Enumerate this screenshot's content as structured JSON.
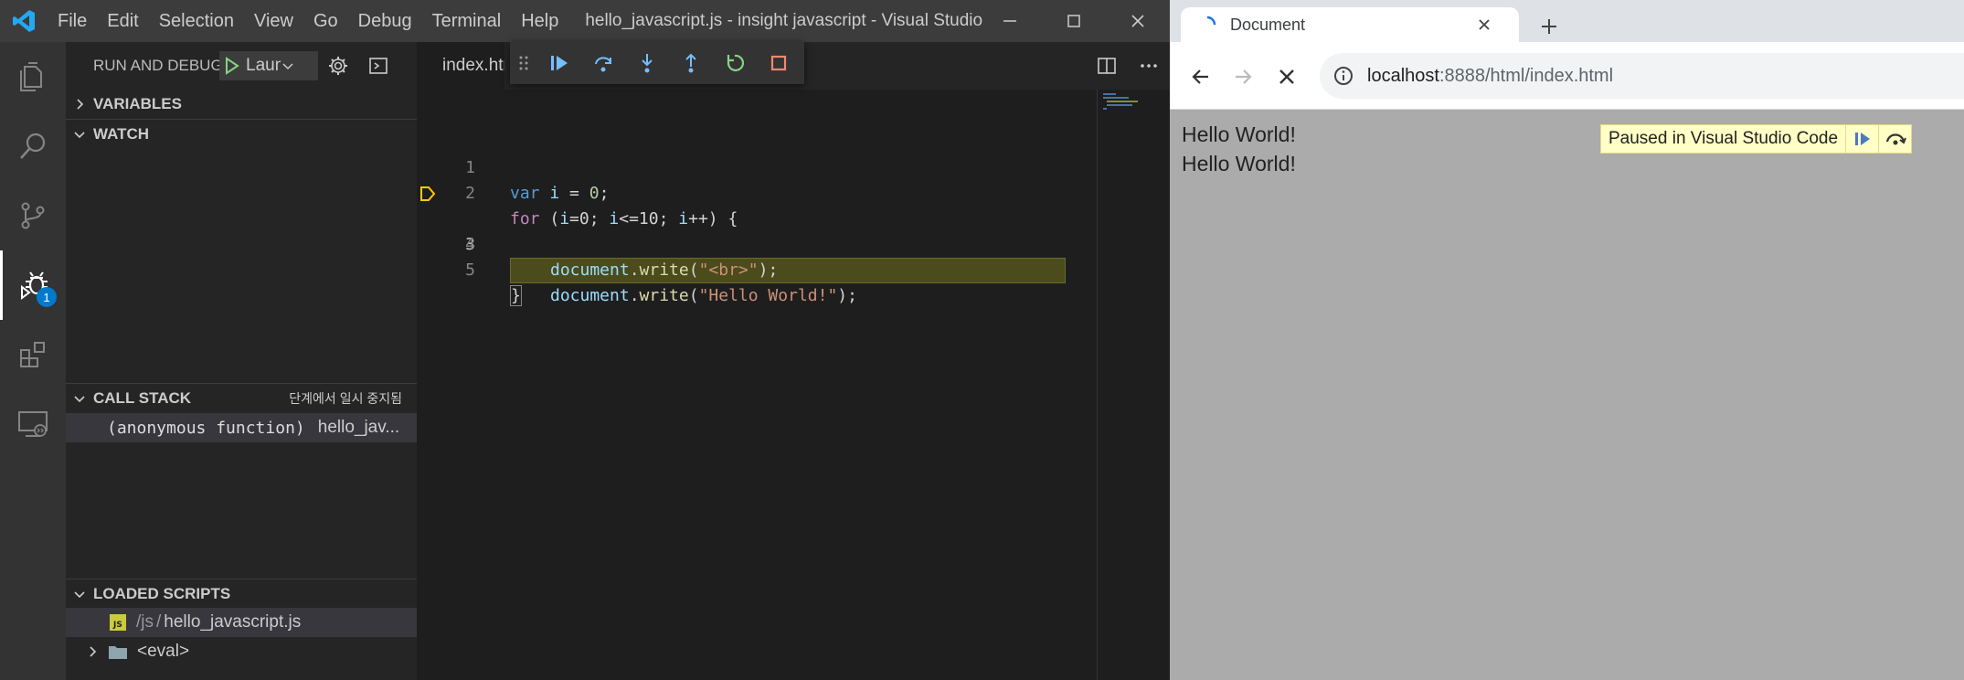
{
  "vscode": {
    "menu": [
      "File",
      "Edit",
      "Selection",
      "View",
      "Go",
      "Debug",
      "Terminal",
      "Help"
    ],
    "window_title": "hello_javascript.js - insight javascript - Visual Studio ...",
    "activity_badge": "1",
    "sidebar": {
      "title": "RUN AND DEBUG",
      "launch_config": "Launch",
      "sections": {
        "variables": "VARIABLES",
        "watch": "WATCH",
        "call_stack": "CALL STACK",
        "call_stack_status": "단계에서 일시 중지됨",
        "loaded_scripts": "LOADED SCRIPTS"
      },
      "call_stack_frames": [
        {
          "function": "(anonymous function)",
          "file": "hello_jav..."
        }
      ],
      "loaded_scripts": [
        {
          "path_prefix": "/js",
          "separator": "/",
          "file": "hello_javascript.js"
        },
        {
          "file": "<eval>"
        }
      ]
    },
    "editor": {
      "tab_label": "index.html",
      "line_numbers": [
        "1",
        "2",
        "3",
        "4",
        "5"
      ],
      "current_line": 3,
      "code": {
        "l1": {
          "kw": "var",
          "id": "i",
          "op": " = ",
          "num": "0",
          "end": ";"
        },
        "l2": {
          "kw": "for",
          "open": " (",
          "a1": "i",
          "a2": "=0; ",
          "b1": "i",
          "b2": "<=10; ",
          "c1": "i",
          "c2": "++) {"
        },
        "l3": {
          "obj": "document",
          "dot": ".",
          "fn": "write",
          "p1": "(",
          "str": "\"Hello World!\"",
          "p2": ");"
        },
        "l4": {
          "obj": "document",
          "dot": ".",
          "fn": "write",
          "p1": "(",
          "str": "\"<br>\"",
          "p2": ");"
        },
        "l5": {
          "text": "}"
        }
      }
    }
  },
  "browser": {
    "tab_title": "Document",
    "url_host": "localhost",
    "url_rest": ":8888/html/index.html",
    "content_lines": [
      "Hello World!",
      "Hello World!"
    ],
    "paused_label": "Paused in Visual Studio Code"
  },
  "colors": {
    "vscode_bg": "#1e1e1e",
    "accent": "#007acc",
    "debug_highlight": "#4b4b1b",
    "paused_overlay": "#ffffc6",
    "browser_content_bg": "#ababab"
  }
}
